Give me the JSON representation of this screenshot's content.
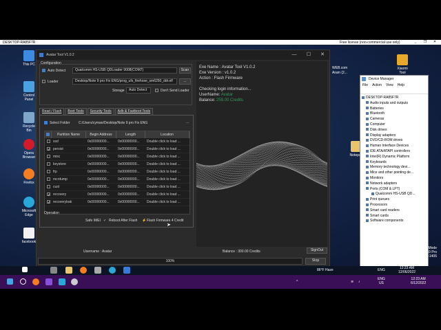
{
  "host_bar": {
    "left_label": "DESKTOP-RA85F7R",
    "center_label": "Free license (non-commercial use only)",
    "minimize": "_",
    "restore": "❐",
    "close": "✕"
  },
  "desktop_icons": [
    {
      "label": "This PC"
    },
    {
      "label": "Control Panel"
    },
    {
      "label": "Recycle Bin"
    },
    {
      "label": "Opera Browser"
    },
    {
      "label": "Firefox"
    },
    {
      "label": "Microsoft Edge"
    },
    {
      "label": "facebook"
    },
    {
      "label": "Xiaomi Tool"
    },
    {
      "label": "Notepad"
    }
  ],
  "desktop_partial_text": {
    "line1": "WEB.com",
    "line2": "Aram (2..."
  },
  "window": {
    "title": "Avatar Tool V1.0.2",
    "minimize": "—",
    "maximize": "☐",
    "close": "✕"
  },
  "configuration": {
    "group_label": "Configuration",
    "auto_detect_label": "Auto Detect",
    "auto_detect_checked": true,
    "port_value": "Qualcomm HS-USB QDLoader 9008(COM7)",
    "scan_label": "Scan",
    "loader_label": "Loader",
    "loader_checked": false,
    "loader_value": "Desktop/Note 9 pro Fix ENG/prog_ufs_firehose_sm6250_ddr.elf",
    "browse_label": "...",
    "storage_label": "Storage",
    "storage_value": "Auto Detect",
    "dont_send_loader_label": "Don't Send Loader"
  },
  "tabs": [
    {
      "label": "Read / Flash",
      "active": true
    },
    {
      "label": "Boot Tools",
      "active": false
    },
    {
      "label": "Security Tools",
      "active": false
    },
    {
      "label": "Adb & Fastboot Tools",
      "active": false
    }
  ],
  "flash_tab": {
    "select_folder_label": "Select Folder",
    "folder_path": "C:/Users/cyman/Desktop/Note 9 pro Fix ENG",
    "folder_browse": "...",
    "columns": [
      "Partition Name",
      "Begin Address",
      "Length",
      "Location"
    ],
    "rows": [
      {
        "checked": false,
        "name": "ssd",
        "begin": "0x00000000...",
        "length": "0x00000000...",
        "location": "Double click to load ..."
      },
      {
        "checked": true,
        "name": "persist",
        "begin": "0x00000000...",
        "length": "0x00000000...",
        "location": "Double click to load ..."
      },
      {
        "checked": false,
        "name": "misc",
        "begin": "0x00000000...",
        "length": "0x00000000...",
        "location": "Double click to load ..."
      },
      {
        "checked": false,
        "name": "keystore",
        "begin": "0x00000000...",
        "length": "0x00000000...",
        "location": "Double click to load ..."
      },
      {
        "checked": false,
        "name": "frp",
        "begin": "0x00000000...",
        "length": "0x00000000...",
        "location": "Double click to load ..."
      },
      {
        "checked": false,
        "name": "mcrdump",
        "begin": "0x00000000...",
        "length": "0x00000000...",
        "location": "Double click to load ..."
      },
      {
        "checked": false,
        "name": "cust",
        "begin": "0x00000000...",
        "length": "0x00000000...",
        "location": "Double click to load ..."
      },
      {
        "checked": true,
        "name": "recovery",
        "begin": "0x00000000...",
        "length": "0x00000000...",
        "location": "Double click to load ..."
      },
      {
        "checked": true,
        "name": "recoverybak",
        "begin": "0x00000000...",
        "length": "0x00000000...",
        "location": "Double click to load ..."
      }
    ],
    "operation_label": "Operation",
    "safe_imei_label": "Safe IMEI",
    "reboot_after_flash_label": "Reboot After Flash",
    "flash_firmware_label": "Flash Firmware 4 Credit"
  },
  "info": {
    "exe_name": "Exe Name : Avatar Tool V1.0.2",
    "exe_version": "Exe Version : v1.0.2",
    "action": "Action : Flash Firmware",
    "checking": "Checking login information...",
    "username_label": "UserName:",
    "username_value": "Avatar",
    "balance_label": "Balance:",
    "balance_value": "259.00 Credits"
  },
  "status": {
    "username": "Username : Avatar",
    "balance": "Balance : 300.00 Credits",
    "signout_label": "SignOut",
    "progress_value": 100,
    "progress_text": "100%",
    "stop_label": "Stop"
  },
  "device_manager": {
    "title": "Device Manager",
    "menu": [
      "File",
      "Action",
      "View",
      "Help"
    ],
    "root": "DESKTOP-RA85F7R",
    "nodes": [
      "Audio inputs and outputs",
      "Batteries",
      "Bluetooth",
      "Cameras",
      "Computer",
      "Disk drives",
      "Display adapters",
      "DVD/CD-ROM drives",
      "Human Interface Devices",
      "IDE ATA/ATAPI controllers",
      "Intel(R) Dynamic Platform",
      "Keyboards",
      "Memory technology devi...",
      "Mice and other pointing de...",
      "Monitors",
      "Network adapters",
      "Ports (COM & LPT)",
      "Qualcomm HS-USB QD...",
      "Print queues",
      "Processors",
      "Smart card readers",
      "Smart cards",
      "Software components"
    ]
  },
  "watermark": {
    "line1": "Test Mode",
    "line2": "Windows 10 Pro",
    "line3": "Build 19041.vb_release.191206-1406"
  },
  "inner_taskbar": {
    "weather": "86°F Haze",
    "lang": "ENG",
    "time": "12:23 AM",
    "date": "12/06/2022"
  },
  "outer_taskbar": {
    "lang_line1": "ENG",
    "lang_line2": "US",
    "time": "12:23 AM",
    "date": "6/12/2022"
  },
  "colors": {
    "accent": "#2e9e5b",
    "outer_taskbar": "#3b0f58",
    "window_bg": "#2b2b2b"
  }
}
